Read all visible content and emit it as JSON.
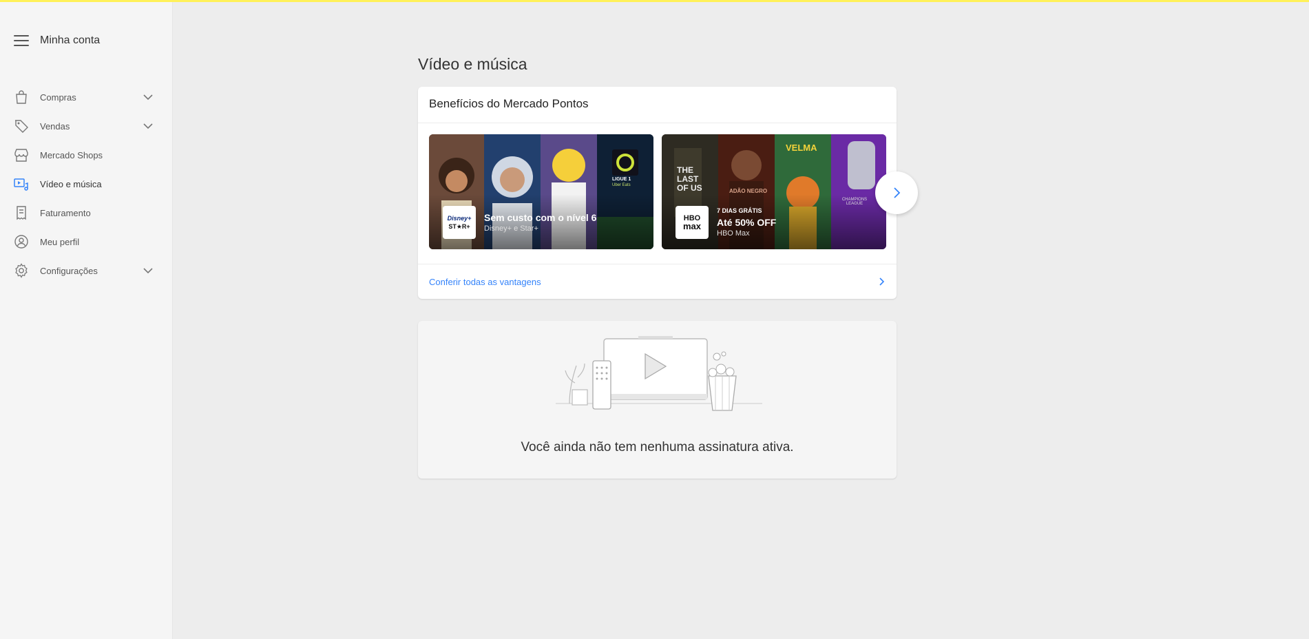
{
  "sidebar": {
    "title": "Minha conta",
    "items": [
      {
        "label": "Compras",
        "icon": "bag-icon",
        "expandable": true
      },
      {
        "label": "Vendas",
        "icon": "tag-icon",
        "expandable": true
      },
      {
        "label": "Mercado Shops",
        "icon": "store-icon",
        "expandable": false
      },
      {
        "label": "Vídeo e música",
        "icon": "video-music-icon",
        "expandable": false,
        "active": true
      },
      {
        "label": "Faturamento",
        "icon": "invoice-icon",
        "expandable": false
      },
      {
        "label": "Meu perfil",
        "icon": "profile-icon",
        "expandable": false
      },
      {
        "label": "Configurações",
        "icon": "gear-icon",
        "expandable": true
      }
    ]
  },
  "page": {
    "title": "Vídeo e música"
  },
  "benefits": {
    "title": "Benefícios do Mercado Pontos",
    "cards": [
      {
        "logo_line1": "Disney+",
        "logo_line2": "ST★R+",
        "headline": "Sem custo com o nível 6",
        "subtitle": "Disney+ e Star+",
        "art_labels": [
          "LIGUE 1",
          "Uber Eats"
        ]
      },
      {
        "logo_line1": "HBO",
        "logo_line2": "max",
        "tag": "7 DIAS GRÁTIS",
        "headline": "Até 50% OFF",
        "subtitle": "HBO Max",
        "art_labels": [
          "THE LAST OF US",
          "ADÃO NEGRO",
          "VELMA",
          "CHAMPIONS LEAGUE"
        ]
      }
    ],
    "link_text": "Conferir todas as vantagens"
  },
  "subscriptions": {
    "empty_message": "Você ainda não tem nenhuma assinatura ativa."
  },
  "colors": {
    "accent": "#3483fa",
    "topline": "#fff159",
    "background": "#ededed"
  }
}
